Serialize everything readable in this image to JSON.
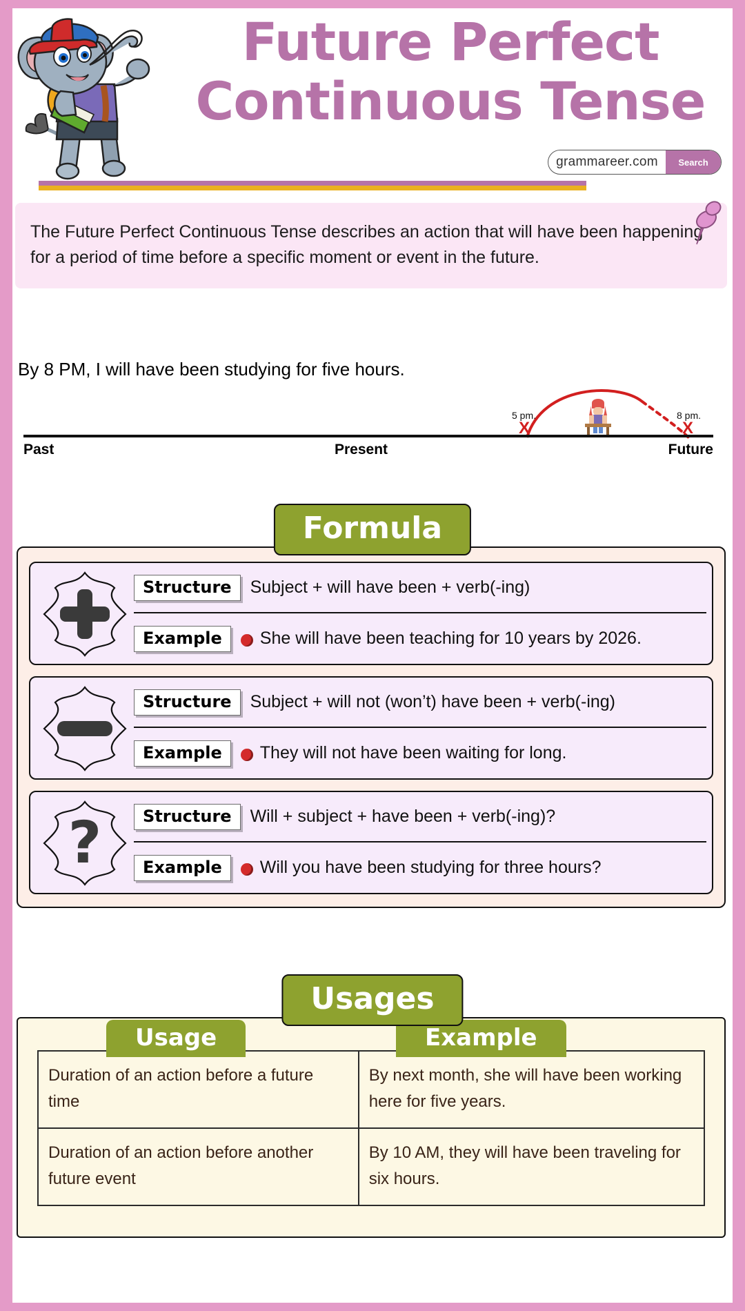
{
  "theme": {
    "frame_color": "#e49bc8",
    "title_color": "#b673a8",
    "accent_green": "#8ea22f",
    "accent_yellow": "#eab120",
    "intro_bg": "#fbe6f5",
    "formula_bg": "#fdeee7",
    "card_bg": "#f7ebfb",
    "usage_bg": "#fdf8e4",
    "bullet_color": "#d42b2b"
  },
  "header": {
    "title_line1": "Future Perfect",
    "title_line2": "Continuous Tense",
    "mascot_icon": "elephant-mascot-icon",
    "pin_icon": "pushpin-icon",
    "search": {
      "domain": "grammareer.com",
      "button_label": "Search"
    }
  },
  "intro": {
    "text": "The Future Perfect Continuous Tense describes an action that will have been happening for a period of time before a specific moment or event in the future."
  },
  "timeline": {
    "sentence": "By 8 PM, I will have been studying for five hours.",
    "labels": {
      "past": "Past",
      "present": "Present",
      "future": "Future"
    },
    "markers": [
      {
        "time": "5 pm.",
        "mark": "X"
      },
      {
        "time": "8 pm.",
        "mark": "X"
      }
    ],
    "figure_icon": "student-at-desk-icon"
  },
  "formula": {
    "banner": "Formula",
    "labels": {
      "structure": "Structure",
      "example": "Example"
    },
    "cards": [
      {
        "sign_icon": "plus-badge-icon",
        "structure": "Subject + will have been + verb(-ing)",
        "example": "She will have been teaching for 10 years by 2026."
      },
      {
        "sign_icon": "minus-badge-icon",
        "structure": "Subject + will not (won’t) have been + verb(-ing)",
        "example": "They will not have been waiting for long."
      },
      {
        "sign_icon": "question-badge-icon",
        "structure": "Will + subject + have been + verb(-ing)?",
        "example": "Will you have been studying for three hours?"
      }
    ]
  },
  "usages": {
    "banner": "Usages",
    "columns": [
      "Usage",
      "Example"
    ],
    "rows": [
      {
        "usage": "Duration of an action before a future time",
        "example": "By next month, she will have been working here for five years."
      },
      {
        "usage": "Duration of an action before another future event",
        "example": "By 10 AM, they will have been traveling for six hours."
      }
    ]
  }
}
